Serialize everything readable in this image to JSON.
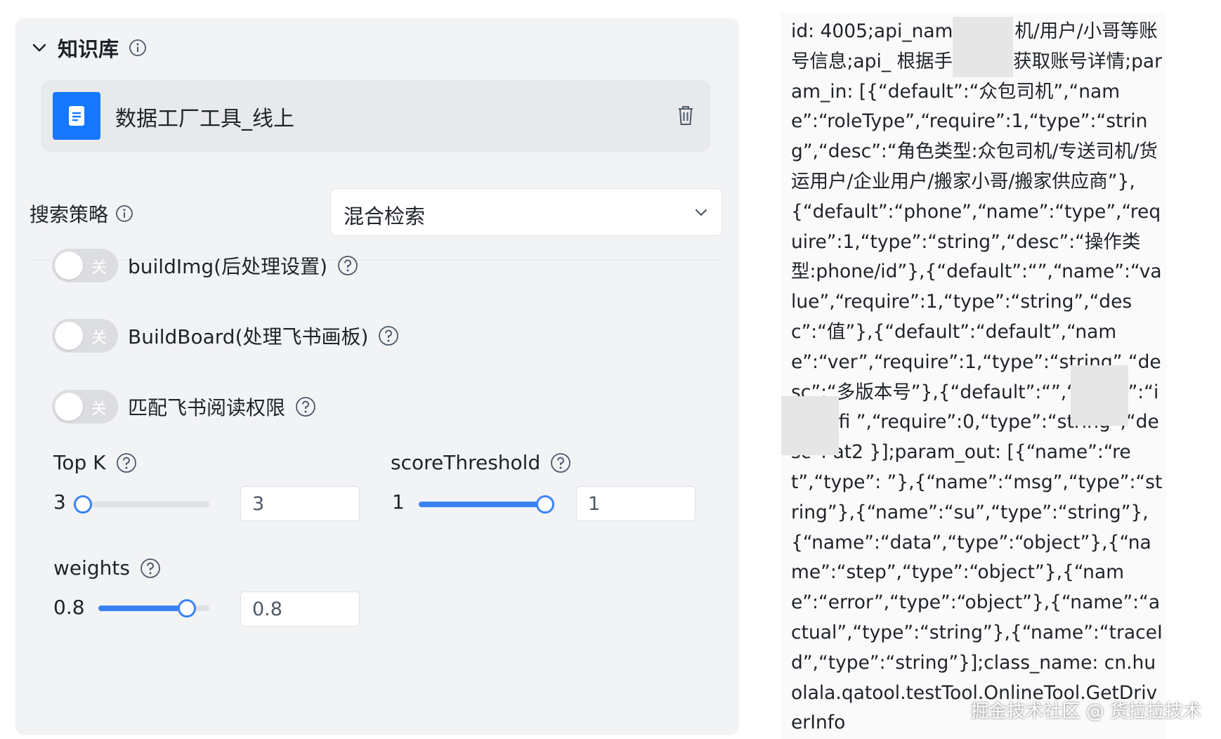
{
  "knowledge": {
    "title": "知识库",
    "doc_name": "数据工厂工具_线上"
  },
  "strategy": {
    "label": "搜索策略",
    "value": "混合检索"
  },
  "toggles": [
    {
      "label": "buildImg(后处理设置)",
      "state_label": "关",
      "on": false
    },
    {
      "label": "BuildBoard(处理飞书画板)",
      "state_label": "关",
      "on": false
    },
    {
      "label": "匹配飞书阅读权限",
      "state_label": "关",
      "on": false
    }
  ],
  "params": {
    "topk": {
      "label": "Top K",
      "value": "3",
      "input": "3",
      "fraction": 0.0
    },
    "score": {
      "label": "scoreThreshold",
      "value": "1",
      "input": "1",
      "fraction": 1.0
    },
    "weights": {
      "label": "weights",
      "value": "0.8",
      "input": "0.8",
      "fraction": 0.8
    }
  },
  "code": {
    "text": "id: 4005;api_nam 获取司机/用户/小哥等账号信息;api_ 根据手机号/id获取账号详情;param_in: [{“default”:“众包司机”,“name”:“roleType”,“require”:1,“type”:“string”,“desc”:“角色类型:众包司机/专送司机/货运用户/企业用户/搬家小哥/搬家供应商”},{“default”:“phone”,“name”:“type”,“require”:1,“type”:“string”,“desc”:“操作类型:phone/id”},{“default”:“”,“name”:“value”,“require”:1,“type”:“string”,“desc”:“值”},{“default”:“default”,“name”:“ver”,“require”:1,“type”:“string”,“desc”:“多版本号”},{“default”:“”,“name”:“identifi ”,“require”:0,“type”:“string”,“desc”: at2 }];param_out: [{“name”:“ret”,“type”: ”},{“name”:“msg”,“type”:“string”},{“name”:“su”,“type”:“string”},{“name”:“data”,“type”:“object”},{“name”:“step”,“type”:“object”},{“name”:“error”,“type”:“object”},{“name”:“actual”,“type”:“string”},{“name”:“traceId”,“type”:“string”}];class_name: cn.huolala.qatool.testTool.OnlineTool.GetDriverInfo"
  },
  "footer": {
    "watermark": "掘金技术社区 @ 货拉拉技术"
  },
  "colors": {
    "accent": "#3b82f6",
    "doc_icon": "#1677ff",
    "panel_bg": "#f2f3f5"
  }
}
